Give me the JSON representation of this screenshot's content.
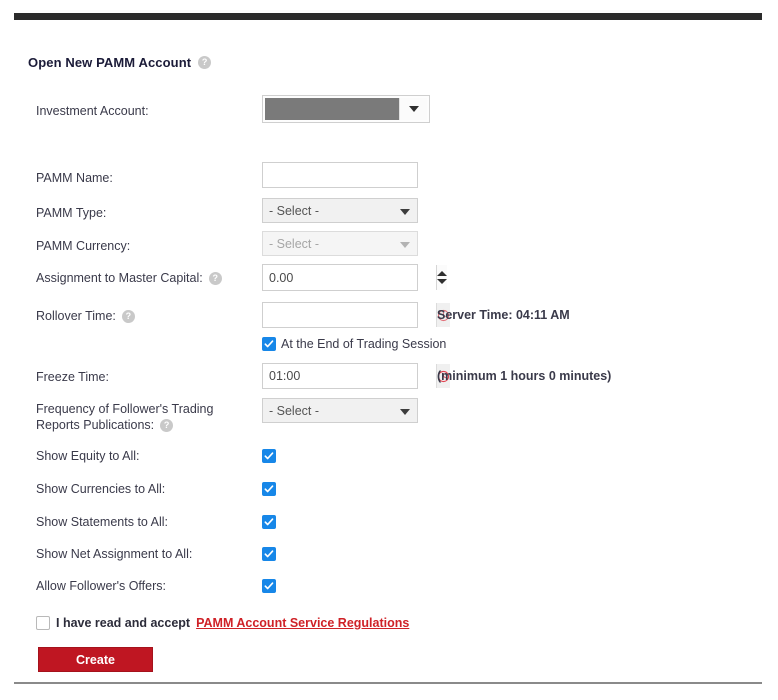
{
  "heading": {
    "title": "Open New PAMM Account",
    "help_icon": "help-circle-icon",
    "help_glyph": "?"
  },
  "fields": {
    "investment_account": {
      "label": "Investment Account:",
      "value": "",
      "icon": "chevron-down-icon"
    },
    "pamm_name": {
      "label": "PAMM Name:",
      "value": "",
      "placeholder": ""
    },
    "pamm_type": {
      "label": "PAMM Type:",
      "value": "- Select -"
    },
    "pamm_currency": {
      "label": "PAMM Currency:",
      "value": "- Select -"
    },
    "assignment": {
      "label": "Assignment to Master Capital:",
      "value": "0.00",
      "help_glyph": "?"
    },
    "rollover_time": {
      "label": "Rollover Time:",
      "value": "",
      "help_glyph": "?",
      "clock_icon": "clock-icon",
      "server_time": "Server Time: 04:11 AM"
    },
    "end_of_session": {
      "label": "At the End of Trading Session",
      "checked": true
    },
    "freeze_time": {
      "label": "Freeze Time:",
      "value": "01:00",
      "clock_icon": "clock-icon",
      "hint": "(minimum 1 hours 0 minutes)"
    },
    "frequency": {
      "label_line1": "Frequency of Follower's Trading",
      "label_line2": "Reports Publications:",
      "value": "- Select -",
      "help_glyph": "?"
    }
  },
  "toggles": [
    {
      "label": "Show Equity to All:",
      "checked": true
    },
    {
      "label": "Show Currencies to All:",
      "checked": true
    },
    {
      "label": "Show Statements to All:",
      "checked": true
    },
    {
      "label": "Show Net Assignment to All:",
      "checked": true
    },
    {
      "label": "Allow Follower's Offers:",
      "checked": true
    }
  ],
  "terms": {
    "checked": false,
    "text": "I have read and accept",
    "link_text": "PAMM Account Service Regulations"
  },
  "create_button": {
    "label": "Create"
  },
  "colors": {
    "accent_red": "#bf1622",
    "link_red": "#cf2127",
    "checkbox_blue": "#1787e8",
    "bar_dark": "#2b2b2b",
    "label_text": "#3a3a4a"
  }
}
